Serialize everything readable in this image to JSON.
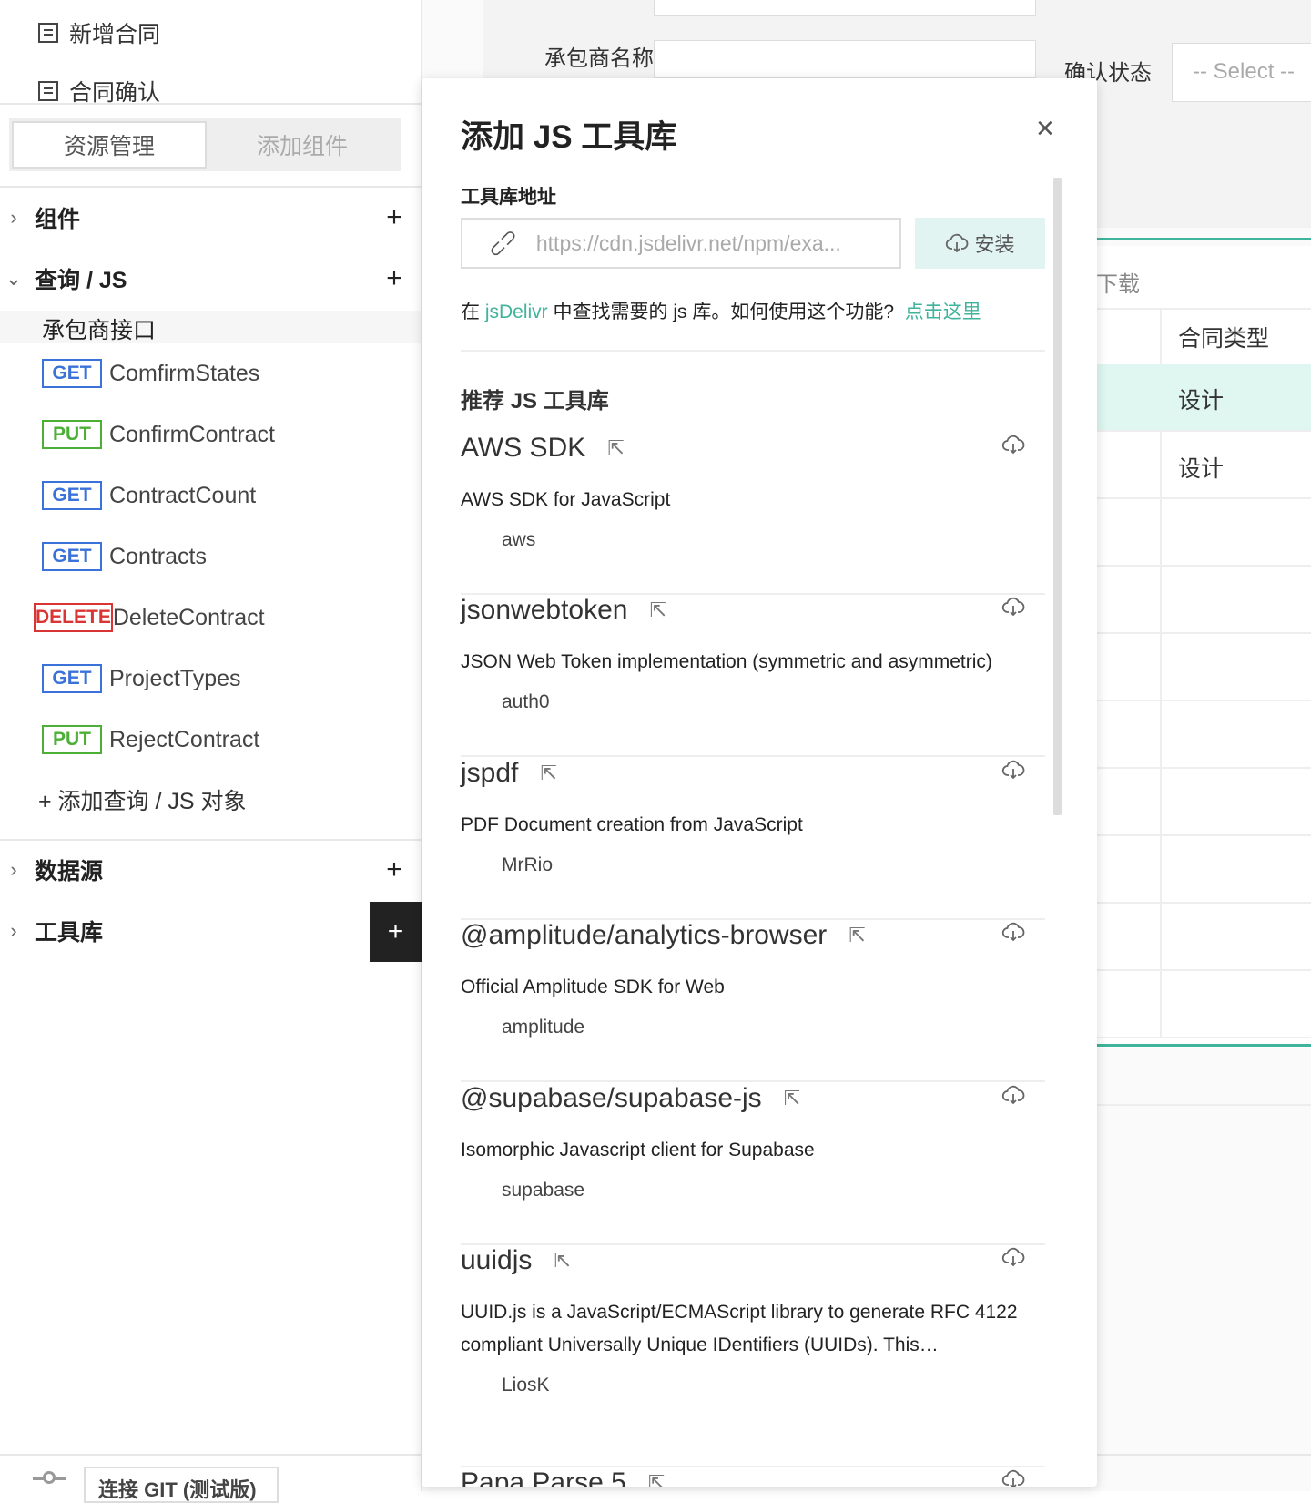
{
  "sidebar": {
    "pages": [
      "新增合同",
      "合同确认"
    ],
    "tabs": [
      "资源管理",
      "添加组件"
    ],
    "sections": {
      "components": "组件",
      "queries": "查询 / JS",
      "datasources": "数据源",
      "libraries": "工具库"
    },
    "group": "承包商接口",
    "apis": [
      {
        "method": "GET",
        "name": "ComfirmStates"
      },
      {
        "method": "PUT",
        "name": "ConfirmContract"
      },
      {
        "method": "GET",
        "name": "ContractCount"
      },
      {
        "method": "GET",
        "name": "Contracts"
      },
      {
        "method": "DELETE",
        "name": "DeleteContract"
      },
      {
        "method": "GET",
        "name": "ProjectTypes"
      },
      {
        "method": "PUT",
        "name": "RejectContract"
      }
    ],
    "add_query": "添加查询 / JS 对象",
    "git_button": "连接 GIT (测试版)"
  },
  "background": {
    "contractor_label": "承包商名称",
    "status_label": "确认状态",
    "status_select": "-- Select --",
    "download": "下载",
    "table_header": "合同类型",
    "rows": [
      "设计",
      "设计"
    ]
  },
  "modal": {
    "title": "添加 JS 工具库",
    "url_label": "工具库地址",
    "url_placeholder": "https://cdn.jsdelivr.net/npm/exa...",
    "install": "安装",
    "help_prefix": "在 ",
    "help_link": "jsDelivr",
    "help_middle": " 中查找需要的 js 库。如何使用这个功能?",
    "help_click": "点击这里",
    "recommended": "推荐 JS 工具库",
    "libraries": [
      {
        "name": "AWS SDK",
        "desc": "AWS SDK for JavaScript",
        "author": "aws"
      },
      {
        "name": "jsonwebtoken",
        "desc": "JSON Web Token implementation (symmetric and asymmetric)",
        "author": "auth0"
      },
      {
        "name": "jspdf",
        "desc": "PDF Document creation from JavaScript",
        "author": "MrRio"
      },
      {
        "name": "@amplitude/analytics-browser",
        "desc": "Official Amplitude SDK for Web",
        "author": "amplitude"
      },
      {
        "name": "@supabase/supabase-js",
        "desc": "Isomorphic Javascript client for Supabase",
        "author": "supabase"
      },
      {
        "name": "uuidjs",
        "desc": "UUID.js is a JavaScript/ECMAScript library to generate RFC 4122 compliant Universally Unique IDentifiers (UUIDs). This…",
        "author": "LiosK"
      },
      {
        "name": "Papa Parse 5",
        "desc": "",
        "author": ""
      }
    ]
  },
  "colors": {
    "accent": "#3fb39b",
    "get": "#3b72d9",
    "put": "#4caf36",
    "delete": "#d93535"
  }
}
